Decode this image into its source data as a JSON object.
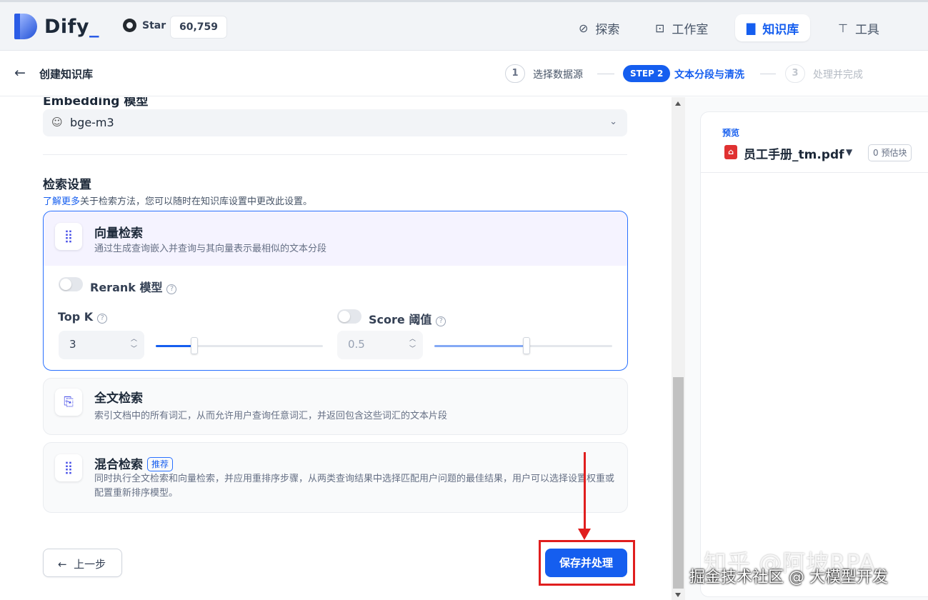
{
  "topbar": {
    "logo_text": "Dify",
    "github_label": "Star",
    "github_count": "60,759",
    "nav": [
      {
        "icon": "explore-icon",
        "label": "探索",
        "active": false
      },
      {
        "icon": "robot-icon",
        "label": "工作室",
        "active": false
      },
      {
        "icon": "book-icon",
        "label": "知识库",
        "active": true
      },
      {
        "icon": "tool-icon",
        "label": "工具",
        "active": false
      }
    ]
  },
  "header": {
    "title": "创建知识库",
    "steps": [
      {
        "num": "1",
        "label": "选择数据源",
        "state": "done"
      },
      {
        "num": "STEP 2",
        "label": "文本分段与清洗",
        "state": "active"
      },
      {
        "num": "3",
        "label": "处理并完成",
        "state": "pending"
      }
    ]
  },
  "embedding": {
    "title": "Embedding 模型",
    "model": "bge-m3"
  },
  "retrieval": {
    "title": "检索设置",
    "desc_link": "了解更多",
    "desc_text": "关于检索方法，您可以随时在知识库设置中更改此设置。",
    "methods": [
      {
        "title": "向量检索",
        "desc": "通过生成查询嵌入并查询与其向量表示最相似的文本分段",
        "selected": true
      },
      {
        "title": "全文检索",
        "desc": "索引文档中的所有词汇，从而允许用户查询任意词汇，并返回包含这些词汇的文本片段",
        "selected": false
      },
      {
        "title": "混合检索",
        "tag": "推荐",
        "desc": "同时执行全文检索和向量检索，并应用重排序步骤，从两类查询结果中选择匹配用户问题的最佳结果，用户可以选择设置权重或配置重新排序模型。",
        "selected": false
      }
    ],
    "rerank_label": "Rerank 模型",
    "rerank_enabled": false,
    "top_k_label": "Top K",
    "top_k_value": "3",
    "top_k_fraction": 0.1,
    "score_label": "Score 阈值",
    "score_enabled": false,
    "score_value": "0.5",
    "score_fraction": 0.5
  },
  "buttons": {
    "prev": "上一步",
    "save": "保存并处理"
  },
  "preview": {
    "label": "预览",
    "file_name": "员工手册_tm.pdf",
    "estimate": "0 预估块"
  },
  "watermark": {
    "line1": "知乎 @阿坡RPA",
    "line2": "掘金技术社区 @ 大模型开发"
  },
  "colors": {
    "accent": "#155eef",
    "annotation": "#e01e1e"
  }
}
